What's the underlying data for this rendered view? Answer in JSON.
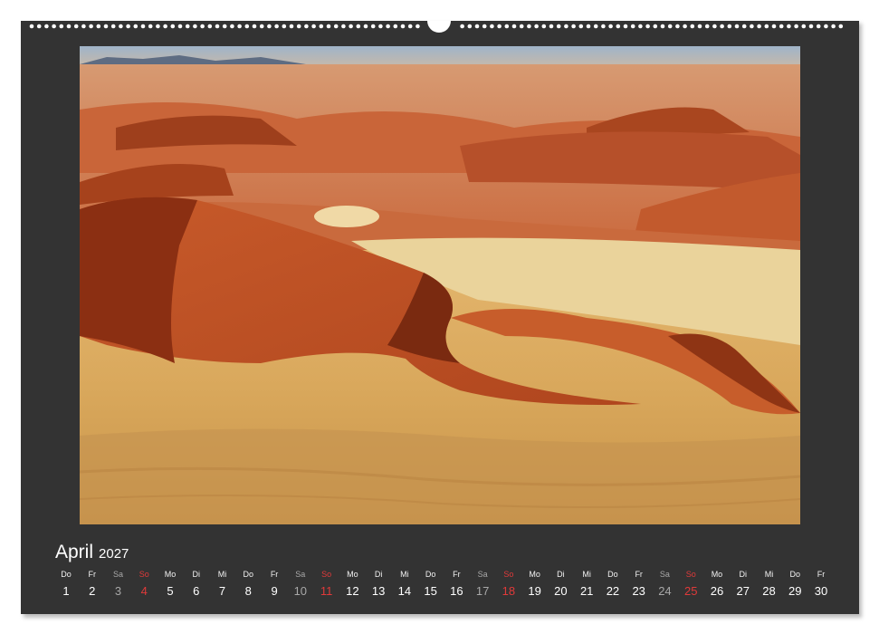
{
  "calendar": {
    "month": "April",
    "year": "2027",
    "colors": {
      "sheet": "#333333",
      "weekday_text": "#ffffff",
      "saturday_text": "#a8a8a8",
      "sunday_text": "#e03a3a"
    },
    "days": [
      {
        "abbr": "Do",
        "num": "1",
        "type": "weekday"
      },
      {
        "abbr": "Fr",
        "num": "2",
        "type": "weekday"
      },
      {
        "abbr": "Sa",
        "num": "3",
        "type": "sat"
      },
      {
        "abbr": "So",
        "num": "4",
        "type": "sun"
      },
      {
        "abbr": "Mo",
        "num": "5",
        "type": "weekday"
      },
      {
        "abbr": "Di",
        "num": "6",
        "type": "weekday"
      },
      {
        "abbr": "Mi",
        "num": "7",
        "type": "weekday"
      },
      {
        "abbr": "Do",
        "num": "8",
        "type": "weekday"
      },
      {
        "abbr": "Fr",
        "num": "9",
        "type": "weekday"
      },
      {
        "abbr": "Sa",
        "num": "10",
        "type": "sat"
      },
      {
        "abbr": "So",
        "num": "11",
        "type": "sun"
      },
      {
        "abbr": "Mo",
        "num": "12",
        "type": "weekday"
      },
      {
        "abbr": "Di",
        "num": "13",
        "type": "weekday"
      },
      {
        "abbr": "Mi",
        "num": "14",
        "type": "weekday"
      },
      {
        "abbr": "Do",
        "num": "15",
        "type": "weekday"
      },
      {
        "abbr": "Fr",
        "num": "16",
        "type": "weekday"
      },
      {
        "abbr": "Sa",
        "num": "17",
        "type": "sat"
      },
      {
        "abbr": "So",
        "num": "18",
        "type": "sun"
      },
      {
        "abbr": "Mo",
        "num": "19",
        "type": "weekday"
      },
      {
        "abbr": "Di",
        "num": "20",
        "type": "weekday"
      },
      {
        "abbr": "Mi",
        "num": "21",
        "type": "weekday"
      },
      {
        "abbr": "Do",
        "num": "22",
        "type": "weekday"
      },
      {
        "abbr": "Fr",
        "num": "23",
        "type": "weekday"
      },
      {
        "abbr": "Sa",
        "num": "24",
        "type": "sat"
      },
      {
        "abbr": "So",
        "num": "25",
        "type": "sun"
      },
      {
        "abbr": "Mo",
        "num": "26",
        "type": "weekday"
      },
      {
        "abbr": "Di",
        "num": "27",
        "type": "weekday"
      },
      {
        "abbr": "Mi",
        "num": "28",
        "type": "weekday"
      },
      {
        "abbr": "Do",
        "num": "29",
        "type": "weekday"
      },
      {
        "abbr": "Fr",
        "num": "30",
        "type": "weekday"
      }
    ]
  }
}
